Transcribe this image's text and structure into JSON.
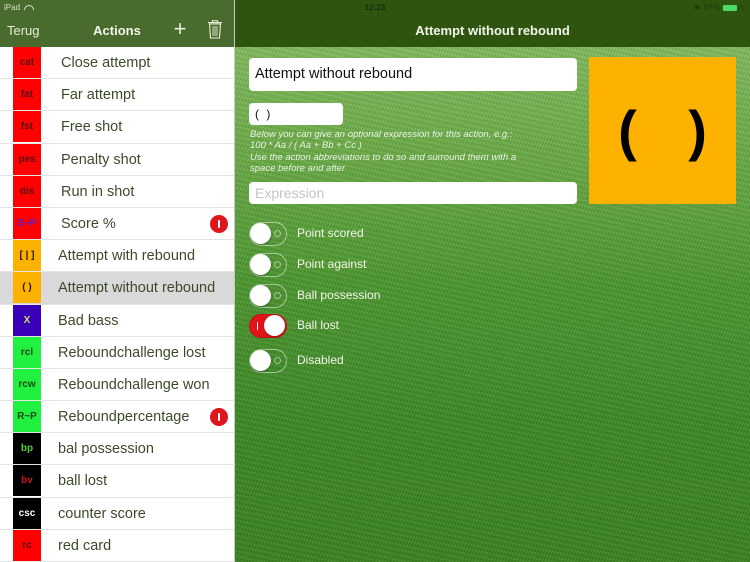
{
  "status_bar": {
    "device": "iPad",
    "time": "12:23",
    "battery": "87%"
  },
  "left_header": {
    "back_label": "Terug",
    "title": "Actions",
    "add_icon": "plus-icon",
    "delete_icon": "trash-icon"
  },
  "actions": [
    {
      "abbr": "cat",
      "label": "Close attempt",
      "bg": "#ff0000",
      "fg": "#5a1010",
      "warning": false,
      "selected": false
    },
    {
      "abbr": "fat",
      "label": "Far attempt",
      "bg": "#ff0000",
      "fg": "#5a1010",
      "warning": false,
      "selected": false
    },
    {
      "abbr": "fst",
      "label": "Free shot",
      "bg": "#ff0000",
      "fg": "#5a1010",
      "warning": false,
      "selected": false
    },
    {
      "abbr": "pes",
      "label": "Penalty shot",
      "bg": "#ff0000",
      "fg": "#5a1010",
      "warning": false,
      "selected": false
    },
    {
      "abbr": "dis",
      "label": "Run in shot",
      "bg": "#ff0000",
      "fg": "#5a1010",
      "warning": false,
      "selected": false
    },
    {
      "abbr": "S~P",
      "label": "Score %",
      "bg": "#ff0000",
      "fg": "#5a1fd0",
      "warning": true,
      "selected": false
    },
    {
      "abbr": "[ | ]",
      "label": "Attempt with rebound",
      "bg": "#fdb100",
      "fg": "#2a1a00",
      "warning": false,
      "selected": false
    },
    {
      "abbr": "( )",
      "label": "Attempt without rebound",
      "bg": "#fdb100",
      "fg": "#2a1a00",
      "warning": false,
      "selected": true
    },
    {
      "abbr": "X",
      "label": "Bad bass",
      "bg": "#3a00b8",
      "fg": "#c8e060",
      "warning": false,
      "selected": false
    },
    {
      "abbr": "rcl",
      "label": "Reboundchallenge lost",
      "bg": "#22f040",
      "fg": "#1a4a1a",
      "warning": false,
      "selected": false
    },
    {
      "abbr": "rcw",
      "label": "Reboundchallenge won",
      "bg": "#22f040",
      "fg": "#1a4a1a",
      "warning": false,
      "selected": false
    },
    {
      "abbr": "R~P",
      "label": "Reboundpercentage",
      "bg": "#22f040",
      "fg": "#1a4a1a",
      "warning": true,
      "selected": false
    },
    {
      "abbr": "bp",
      "label": "bal possession",
      "bg": "#000000",
      "fg": "#4cd02c",
      "warning": false,
      "selected": false
    },
    {
      "abbr": "bv",
      "label": "ball lost",
      "bg": "#000000",
      "fg": "#c01818",
      "warning": false,
      "selected": false
    },
    {
      "abbr": "csc",
      "label": "counter score",
      "bg": "#000000",
      "fg": "#ffffff",
      "warning": false,
      "selected": false
    },
    {
      "abbr": "rc",
      "label": "red card",
      "bg": "#ff0000",
      "fg": "#5a1010",
      "warning": false,
      "selected": false
    }
  ],
  "detail": {
    "title": "Attempt without rebound",
    "name_value": "Attempt without rebound",
    "abbr_value": "( )",
    "help_lines": [
      "Below you can give an optional expression for this action, e.g.:",
      "100 * Aa / ( Aa + Bb + Cc )",
      "Use the action abbreviations to do so and surround them with a",
      "space before and after"
    ],
    "expression_value": "",
    "expression_placeholder": "Expression",
    "preview_text": "( )",
    "preview_color": "#fdb100",
    "toggles": [
      {
        "label": "Point scored",
        "on": false
      },
      {
        "label": "Point against",
        "on": false
      },
      {
        "label": "Ball possession",
        "on": false
      },
      {
        "label": "Ball lost",
        "on": true
      },
      {
        "label": "Disabled",
        "on": false
      }
    ]
  }
}
